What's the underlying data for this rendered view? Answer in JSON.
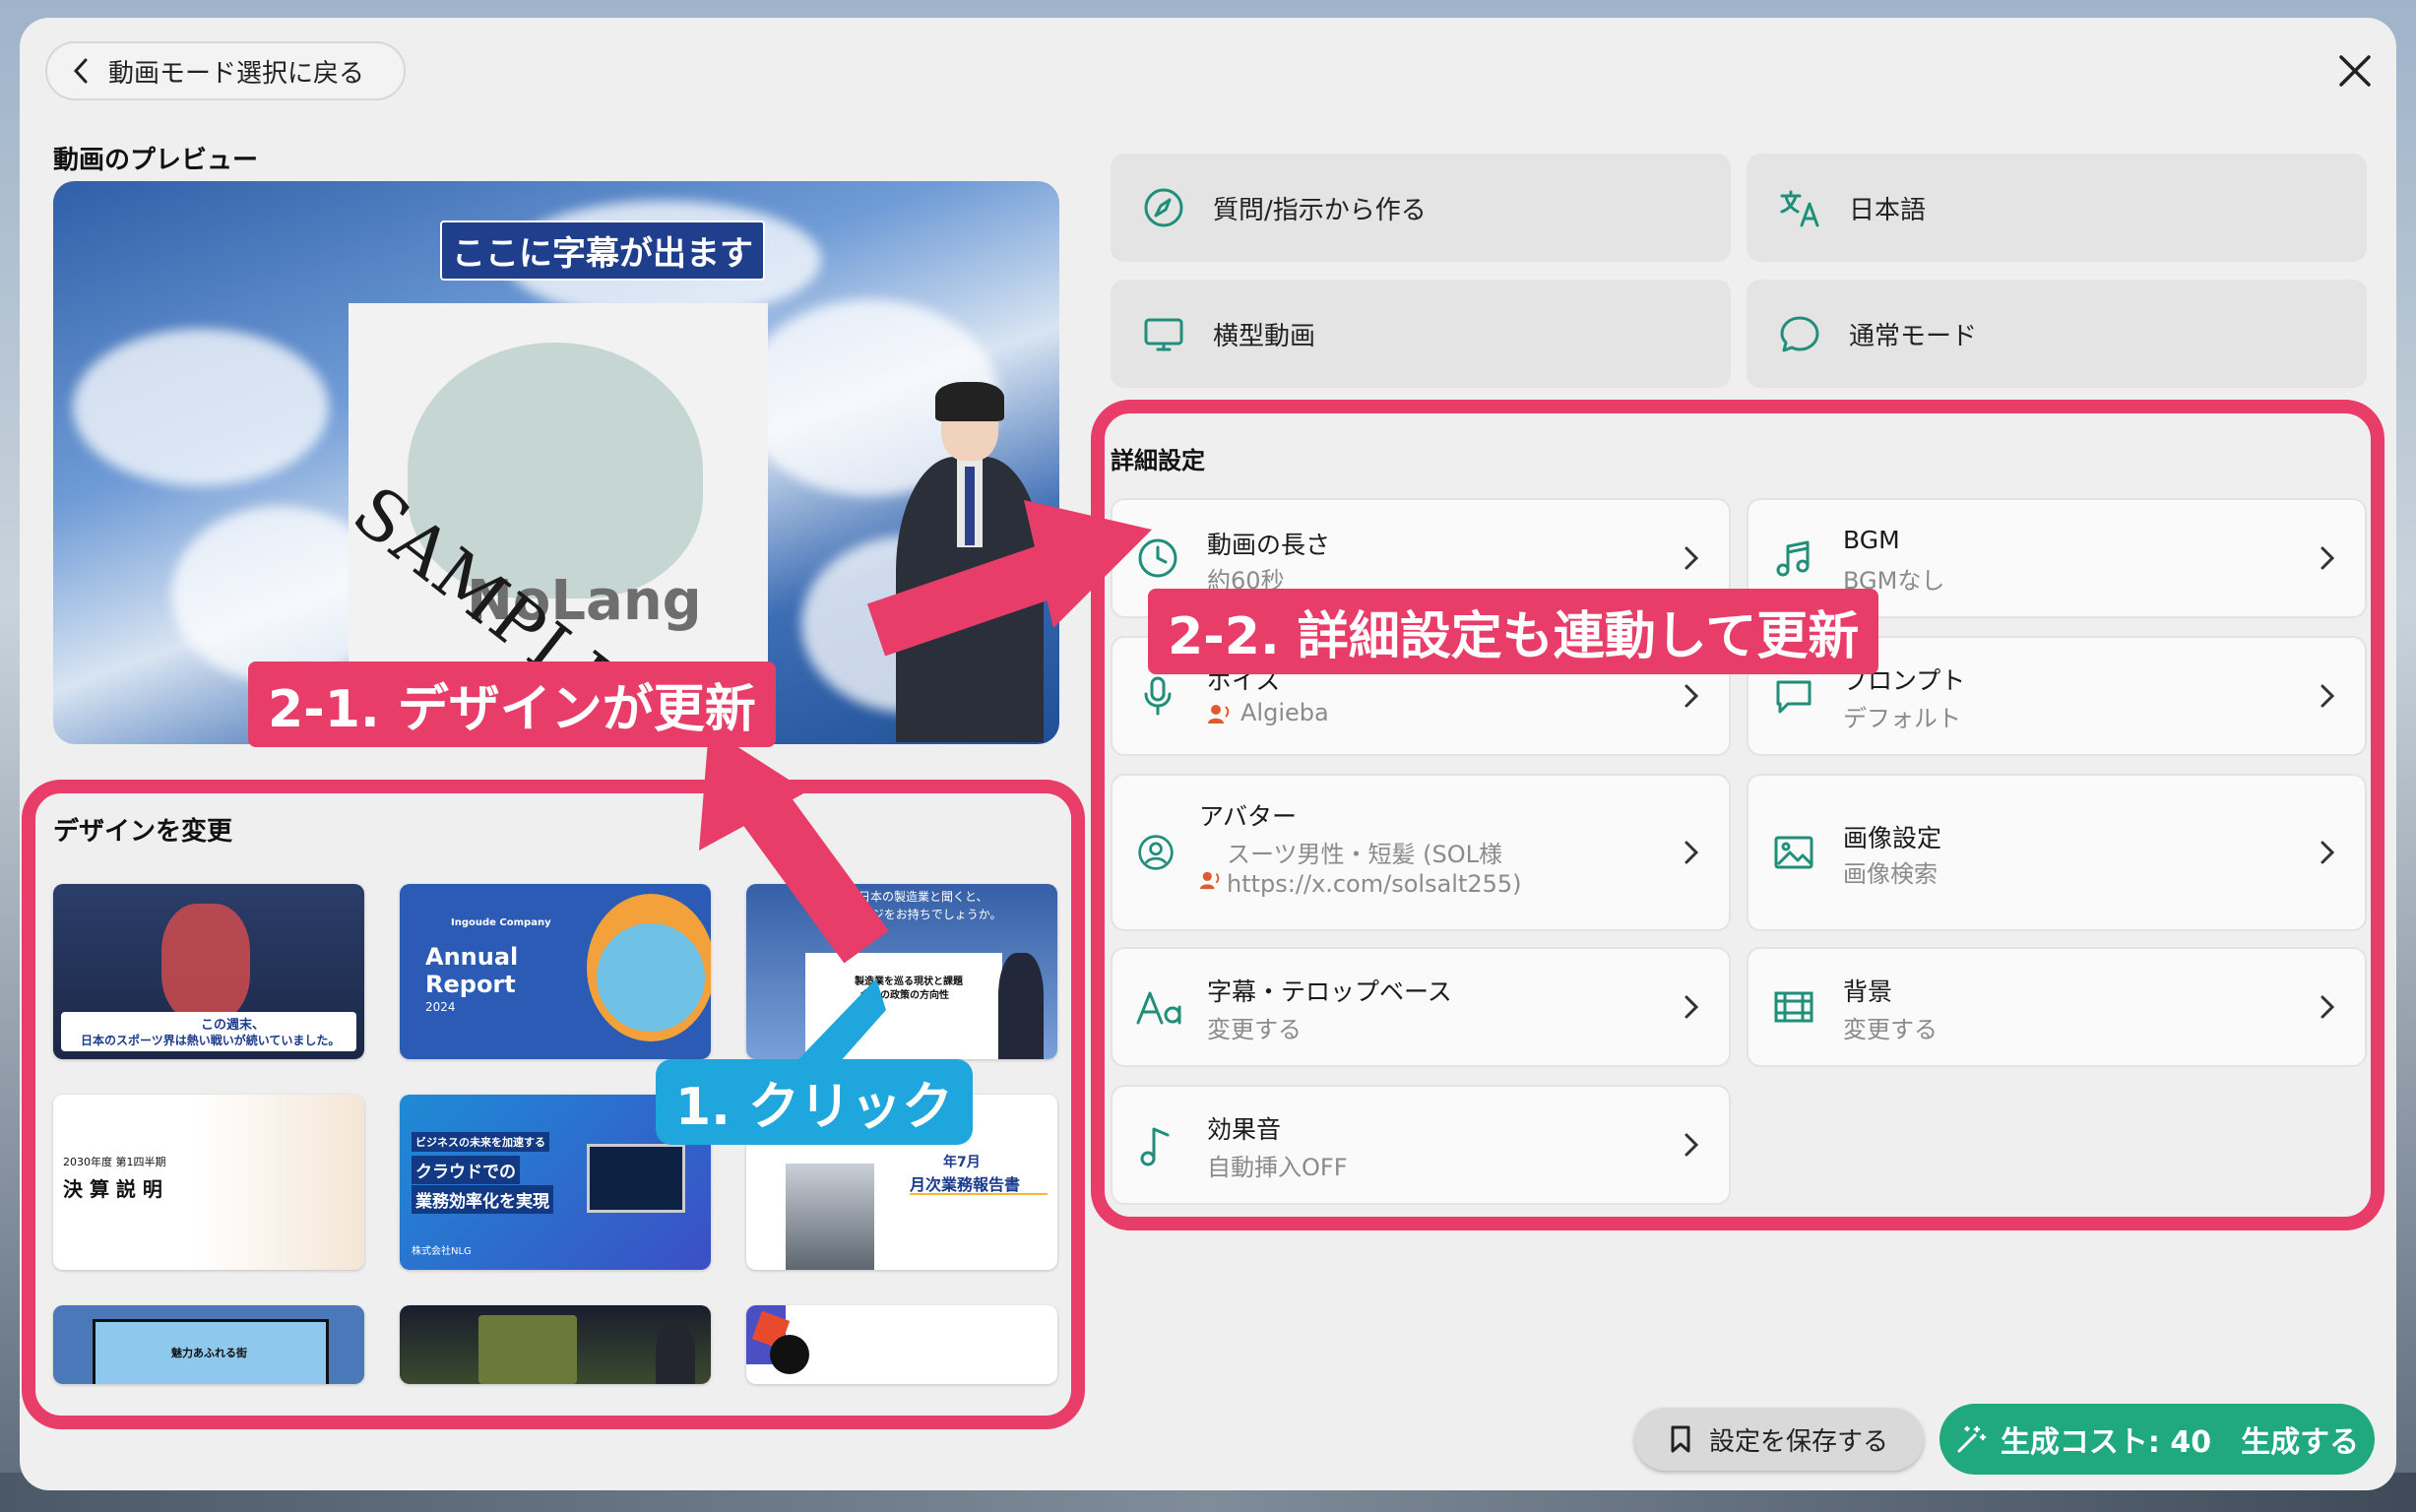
{
  "header": {
    "back_label": "動画モード選択に戻る"
  },
  "preview": {
    "section_title": "動画のプレビュー",
    "subtitle_placeholder": "ここに字幕が出ます",
    "watermark": "SAMPLE",
    "logo_text": "NoLang"
  },
  "design": {
    "section_title": "デザインを変更",
    "thumbs": [
      {
        "line1": "この週末、",
        "line2": "日本のスポーツ界は熱い戦いが続いていました。"
      },
      {
        "line1": "Ingoude Company",
        "line2": "Annual",
        "line3": "Report",
        "line4": "2024"
      },
      {
        "line1": "ん、日本の製造業と聞くと、",
        "line2": "なイメージをお持ちでしょうか。",
        "line3": "製造業を巡る現状と課題",
        "line4": "今後の政策の方向性"
      },
      {
        "line1": "2030年度 第1四半期",
        "line2": "決 算 説 明"
      },
      {
        "line1": "ビジネスの未来を加速する",
        "line2": "クラウドでの",
        "line3": "業務効率化を実現",
        "line4": "株式会社NLG"
      },
      {
        "line1": "年7月",
        "line2": "月次業務報告書"
      },
      {
        "line1": "魅力あふれる街"
      },
      {},
      {}
    ]
  },
  "options": {
    "mode": "質問/指示から作る",
    "language": "日本語",
    "orientation": "横型動画",
    "conversation": "通常モード"
  },
  "details": {
    "section_title": "詳細設定",
    "length": {
      "label": "動画の長さ",
      "value": "約60秒"
    },
    "bgm": {
      "label": "BGM",
      "value": "BGMなし"
    },
    "voice": {
      "label": "ボイス",
      "value": "Algieba"
    },
    "prompt": {
      "label": "プロンプト",
      "value": "デフォルト"
    },
    "avatar": {
      "label": "アバター",
      "value1": "スーツ男性・短髪 (SOL様",
      "value2": "https://x.com/solsalt255)"
    },
    "image": {
      "label": "画像設定",
      "value": "画像検索"
    },
    "caption": {
      "label": "字幕・テロップベース",
      "value": "変更する"
    },
    "background": {
      "label": "背景",
      "value": "変更する"
    },
    "sfx": {
      "label": "効果音",
      "value": "自動挿入OFF"
    }
  },
  "annotations": {
    "a21": "2-1. デザインが更新",
    "a22": "2-2. 詳細設定も連動して更新",
    "a1": "1. クリック"
  },
  "footer": {
    "save_label": "設定を保存する",
    "cost_label": "生成コスト: 40",
    "generate_label": "生成する"
  },
  "colors": {
    "accent": "#1fa97c",
    "annotation": "#e83d68",
    "annotation_blue": "#1fa6dc",
    "icon": "#1f8f7a"
  }
}
